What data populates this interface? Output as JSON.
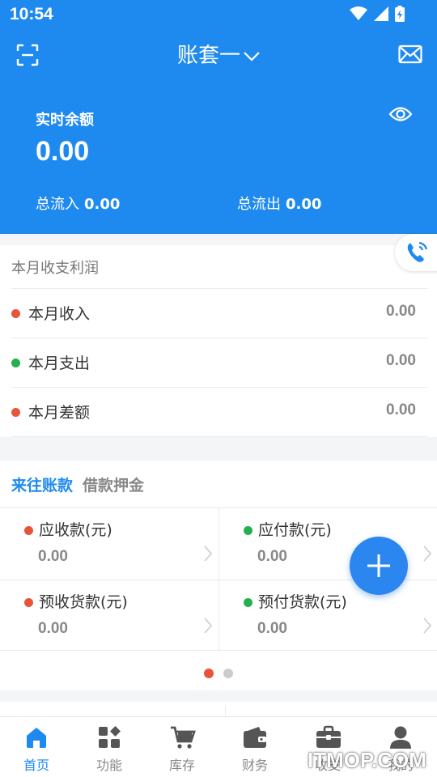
{
  "status": {
    "time": "10:54"
  },
  "header": {
    "title": "账套一"
  },
  "balance": {
    "label": "实时余额",
    "value": "0.00",
    "inflow_label": "总流入",
    "inflow_value": "0.00",
    "outflow_label": "总流出",
    "outflow_value": "0.00"
  },
  "month": {
    "title": "本月收支利润",
    "rows": [
      {
        "label": "本月收入",
        "value": "0.00",
        "color": "#e8543a"
      },
      {
        "label": "本月支出",
        "value": "0.00",
        "color": "#22b14c"
      },
      {
        "label": "本月差额",
        "value": "0.00",
        "color": "#e8543a"
      }
    ]
  },
  "accounts": {
    "tabs": [
      "来往账款",
      "借款押金"
    ],
    "cells": [
      {
        "label": "应收款(元)",
        "value": "0.00",
        "color": "#e8543a"
      },
      {
        "label": "应付款(元)",
        "value": "0.00",
        "color": "#22b14c"
      },
      {
        "label": "预收货款(元)",
        "value": "0.00",
        "color": "#e8543a"
      },
      {
        "label": "预付货款(元)",
        "value": "0.00",
        "color": "#22b14c"
      }
    ],
    "pager_colors": {
      "active": "#e8543a",
      "inactive": "#cccccc"
    }
  },
  "nav": [
    {
      "label": "首页",
      "icon": "home-icon"
    },
    {
      "label": "功能",
      "icon": "apps-icon"
    },
    {
      "label": "库存",
      "icon": "cart-icon"
    },
    {
      "label": "财务",
      "icon": "wallet-icon"
    },
    {
      "label": "收支",
      "icon": "briefcase-icon"
    },
    {
      "label": "我的",
      "icon": "user-icon"
    }
  ],
  "watermark": "ITMOP.COM",
  "colors": {
    "primary": "#1e8af0",
    "red": "#e8543a",
    "green": "#22b14c"
  }
}
